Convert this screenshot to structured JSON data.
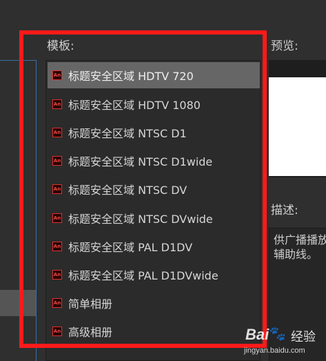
{
  "labels": {
    "template": "模板:",
    "preview": "预览:",
    "description": "描述:"
  },
  "templates": [
    {
      "label": "标题安全区域 HDTV 720",
      "icon": "an-file-icon",
      "selected": true
    },
    {
      "label": "标题安全区域 HDTV 1080",
      "icon": "an-file-icon",
      "selected": false
    },
    {
      "label": "标题安全区域 NTSC D1",
      "icon": "an-file-icon",
      "selected": false
    },
    {
      "label": "标题安全区域 NTSC D1wide",
      "icon": "an-file-icon",
      "selected": false
    },
    {
      "label": "标题安全区域 NTSC DV",
      "icon": "an-file-icon",
      "selected": false
    },
    {
      "label": "标题安全区域 NTSC DVwide",
      "icon": "an-file-icon",
      "selected": false
    },
    {
      "label": "标题安全区域 PAL D1DV",
      "icon": "an-file-icon",
      "selected": false
    },
    {
      "label": "标题安全区域 PAL D1DVwide",
      "icon": "an-file-icon",
      "selected": false
    },
    {
      "label": "简单相册",
      "icon": "an-file-icon",
      "selected": false
    },
    {
      "label": "高级相册",
      "icon": "an-file-icon",
      "selected": false
    }
  ],
  "icon_text": "An",
  "description": {
    "line1": "供广播播放",
    "line2": "辅助线。"
  },
  "watermark": {
    "logo": "Bai",
    "brand": "经验",
    "url": "jingyan.baidu.com"
  },
  "colors": {
    "background": "#2f2f2f",
    "selected_row": "#666666",
    "highlight_frame": "#ff1a1a",
    "icon_red": "#e0312c"
  }
}
